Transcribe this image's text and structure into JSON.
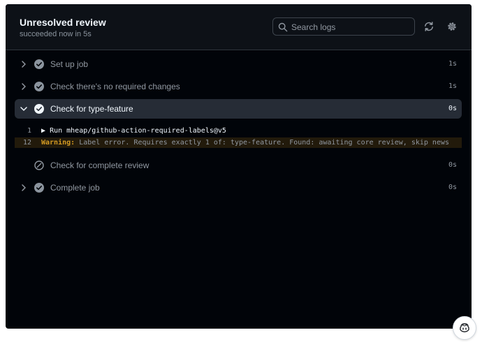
{
  "header": {
    "title": "Unresolved review",
    "subtitle": "succeeded now in 5s",
    "search_placeholder": "Search logs",
    "refresh_icon": "sync-icon",
    "settings_icon": "gear-icon"
  },
  "steps": [
    {
      "label": "Set up job",
      "duration": "1s",
      "status": "success",
      "expanded": false
    },
    {
      "label": "Check there's no required changes",
      "duration": "1s",
      "status": "success",
      "expanded": false
    },
    {
      "label": "Check for type-feature",
      "duration": "0s",
      "status": "success",
      "expanded": true
    },
    {
      "label": "Check for complete review",
      "duration": "0s",
      "status": "skipped",
      "expanded": false
    },
    {
      "label": "Complete job",
      "duration": "0s",
      "status": "success",
      "expanded": false
    }
  ],
  "log": {
    "lines": [
      {
        "number": "1",
        "caret": "▶",
        "text": "Run mheap/github-action-required-labels@v5"
      },
      {
        "number": "12",
        "warning_label": "Warning:",
        "text": "Label error. Requires exactly 1 of: type-feature. Found: awaiting core review, skip news"
      }
    ]
  },
  "colors": {
    "panel_bg": "#010409",
    "header_bg": "#0d1117",
    "active_row_bg": "#262c36",
    "warning": "#d29922",
    "text_primary": "#f0f6fc",
    "text_muted": "#9198a1"
  },
  "copilot_button_icon": "copilot-icon"
}
